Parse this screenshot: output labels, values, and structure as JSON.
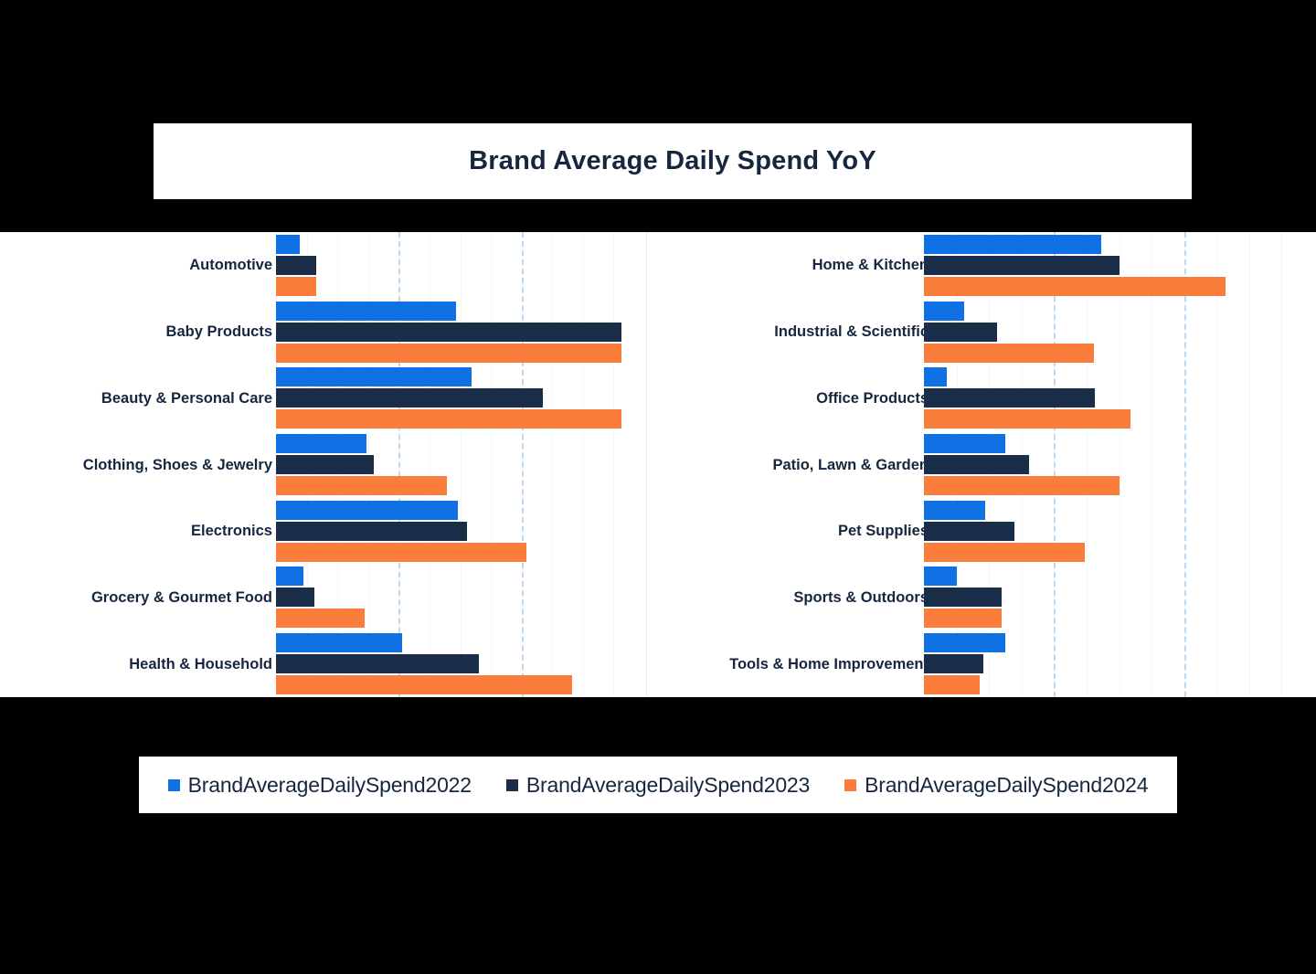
{
  "title": "Brand Average Daily Spend YoY",
  "colors": {
    "series_2022": "#1071E5",
    "series_2023": "#1A2E4A",
    "series_2024": "#FA7D3B",
    "title_text": "#16263F",
    "gridline_major": "#BCD7F0",
    "gridline_minor": "#F4F5F7",
    "card_background": "#FFFFFF",
    "page_background": "#000000"
  },
  "legend": {
    "position": "bottom",
    "items": [
      {
        "label": "BrandAverageDailySpend2022",
        "color": "#1071E5",
        "swatch": "square-marker"
      },
      {
        "label": "BrandAverageDailySpend2023",
        "color": "#1A2E4A",
        "swatch": "square-marker"
      },
      {
        "label": "BrandAverageDailySpend2024",
        "color": "#FA7D3B",
        "swatch": "square-marker"
      }
    ]
  },
  "chart_data": {
    "type": "bar",
    "orientation": "horizontal",
    "title": "Brand Average Daily Spend YoY",
    "xlabel": "",
    "ylabel": "",
    "grid": true,
    "gridlines_major_at": [
      2.0,
      4.0
    ],
    "xlim": [
      0,
      6.0
    ],
    "legend_position": "bottom",
    "panels": [
      {
        "name": "left-panel",
        "categories": [
          "Automotive",
          "Baby Products",
          "Beauty & Personal Care",
          "Clothing, Shoes & Jewelry",
          "Electronics",
          "Grocery & Gourmet Food",
          "Health & Household"
        ],
        "series": [
          {
            "name": "BrandAverageDailySpend2022",
            "values": [
              0.39,
              2.93,
              3.19,
              1.47,
              2.96,
              0.44,
              2.06
            ]
          },
          {
            "name": "BrandAverageDailySpend2023",
            "values": [
              0.65,
              5.63,
              4.35,
              1.6,
              3.11,
              0.63,
              3.3
            ]
          },
          {
            "name": "BrandAverageDailySpend2024",
            "values": [
              0.65,
              5.63,
              5.63,
              2.78,
              4.08,
              1.45,
              4.82
            ]
          }
        ]
      },
      {
        "name": "right-panel",
        "categories": [
          "Home & Kitchen",
          "Industrial & Scientific",
          "Office Products",
          "Patio, Lawn & Garden",
          "Pet Supplies",
          "Sports & Outdoors",
          "Tools & Home Improvement"
        ],
        "series": [
          {
            "name": "BrandAverageDailySpend2022",
            "values": [
              2.72,
              0.62,
              0.35,
              1.25,
              0.94,
              0.5,
              1.25
            ]
          },
          {
            "name": "BrandAverageDailySpend2023",
            "values": [
              3.01,
              1.12,
              2.63,
              1.61,
              1.39,
              1.19,
              0.92
            ]
          },
          {
            "name": "BrandAverageDailySpend2024",
            "values": [
              4.63,
              2.62,
              3.18,
              3.0,
              2.47,
              1.19,
              0.86
            ]
          }
        ]
      }
    ]
  }
}
